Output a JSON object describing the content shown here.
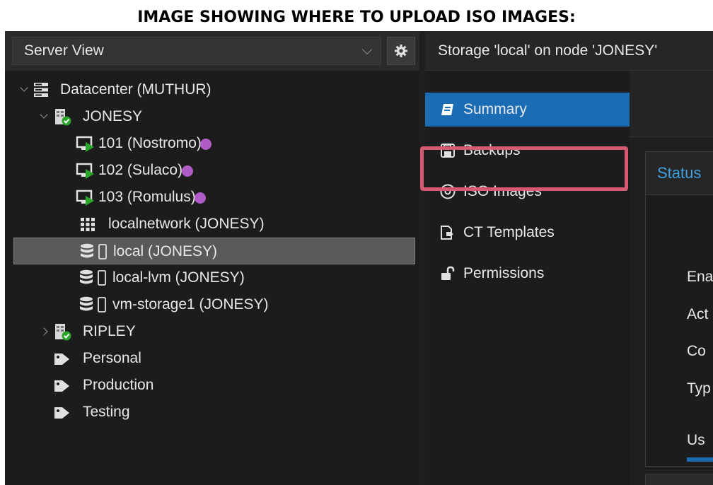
{
  "caption": "IMAGE SHOWING WHERE TO UPLOAD ISO IMAGES:",
  "view_selector": {
    "label": "Server View"
  },
  "tree": [
    {
      "label": "Datacenter (MUTHUR)"
    },
    {
      "label": "JONESY"
    },
    {
      "label": "101 (Nostromo)"
    },
    {
      "label": "102 (Sulaco)"
    },
    {
      "label": "103 (Romulus)"
    },
    {
      "label": "localnetwork (JONESY)"
    },
    {
      "label": "local (JONESY)"
    },
    {
      "label": "local-lvm (JONESY)"
    },
    {
      "label": "vm-storage1 (JONESY)"
    },
    {
      "label": "RIPLEY"
    },
    {
      "label": "Personal"
    },
    {
      "label": "Production"
    },
    {
      "label": "Testing"
    }
  ],
  "content_title": "Storage 'local' on node 'JONESY'",
  "nav": [
    {
      "label": "Summary",
      "icon": "book-icon"
    },
    {
      "label": "Backups",
      "icon": "floppy-icon"
    },
    {
      "label": "ISO Images",
      "icon": "disc-icon"
    },
    {
      "label": "CT Templates",
      "icon": "template-icon"
    },
    {
      "label": "Permissions",
      "icon": "unlock-icon"
    }
  ],
  "status": {
    "title": "Status",
    "rows": [
      "Ena",
      "Act",
      "Co",
      "Typ"
    ],
    "usage_label": "Us"
  },
  "colors": {
    "accent": "#1a6db5",
    "highlight": "#d65a72",
    "vm_tag": "#b05cc6",
    "running": "#2aa52a",
    "status_title": "#3f9fe0"
  }
}
